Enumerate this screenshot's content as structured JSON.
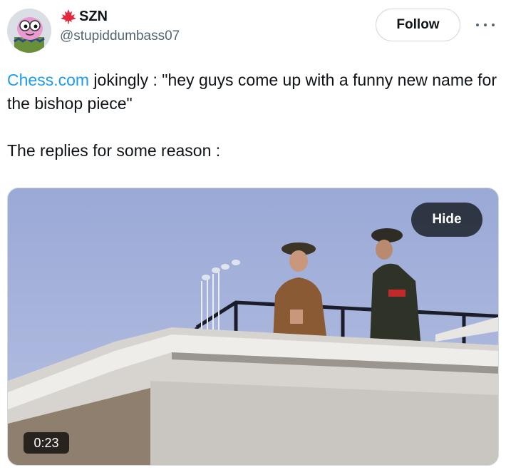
{
  "author": {
    "display_name": "SZN",
    "handle": "@stupiddumbass07",
    "avatar_icon": "cartoon-avatar-icon",
    "flag_icon": "maple-leaf-icon"
  },
  "actions": {
    "follow_label": "Follow",
    "more_icon": "more-options-icon"
  },
  "tweet": {
    "mention": "Chess.com",
    "line1_rest": " jokingly : \"hey guys come up with a funny new name for the bishop piece\"",
    "line2": "The replies for some reason :"
  },
  "media": {
    "hide_label": "Hide",
    "duration": "0:23"
  },
  "colors": {
    "link": "#1d9bf0",
    "secondary_text": "#536471",
    "border": "#cfd9de"
  }
}
